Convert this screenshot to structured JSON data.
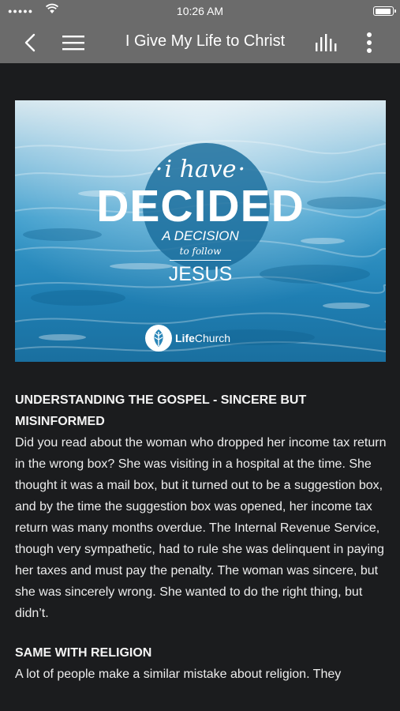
{
  "status_bar": {
    "signal_dots": "●●●●●",
    "time": "10:26 AM",
    "battery_level": 0.95
  },
  "nav": {
    "title": "I Give My Life to Christ",
    "back_icon": "chevron-left-icon",
    "menu_icon": "hamburger-icon",
    "audio_icon": "audio-bars-icon",
    "more_icon": "vertical-dots-icon"
  },
  "hero_image": {
    "script_title": "i have",
    "big_title": "DECIDED",
    "decision_line": "A DECISION",
    "follow_line": "to follow",
    "jesus_line": "JESUS",
    "brand_bold": "Life",
    "brand_rest": "Church",
    "accent_color": "#1b6e9c"
  },
  "article": {
    "sections": [
      {
        "heading": "UNDERSTANDING THE GOSPEL - SINCERE BUT MISINFORMED",
        "body": "Did you read about the woman who dropped her income tax return in the wrong box? She was visiting in a hospital at the time. She thought it was a mail box, but it turned out to be a suggestion box, and by the time the suggestion box was opened, her income tax return was many months overdue. The Internal Revenue Service, though very sympathetic, had to rule she was delinquent in paying her taxes and must pay the penalty. The woman was sincere, but she was sincerely wrong. She wanted to do the right thing, but didn’t."
      },
      {
        "heading": "SAME WITH RELIGION",
        "body": "A lot of people make a similar mistake about religion. They"
      }
    ]
  }
}
